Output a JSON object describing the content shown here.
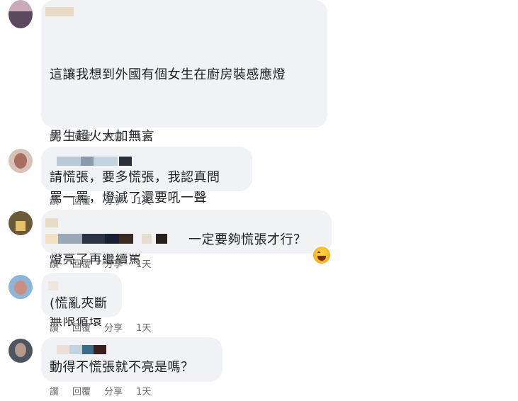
{
  "comments": [
    {
      "lines": [
        "這讓我想到外國有個女生在廚房裝感應燈",
        "男生超火大加無言",
        "罵一罵，燈滅了還要吼一聲",
        "燈亮了再繼續罵",
        "無限循環"
      ],
      "actions": {
        "like": "讚",
        "reply": "回覆",
        "share": "分享",
        "time": "1天"
      }
    },
    {
      "lines": [
        "請慌張，要多慌張，我認真問"
      ],
      "actions": {
        "like": "讚",
        "reply": "回覆",
        "share": "分享",
        "time": "1天"
      }
    },
    {
      "lines": [
        "一定要夠慌張才行？"
      ],
      "actions": {
        "like": "讚",
        "reply": "回覆",
        "share": "分享",
        "time": "1天"
      },
      "reaction": "laughing-emoji"
    },
    {
      "lines": [
        "(慌亂夾斷"
      ],
      "actions": {
        "like": "讚",
        "reply": "回覆",
        "share": "分享",
        "time": "1天"
      }
    },
    {
      "lines": [
        "動得不慌張就不亮是嗎？"
      ],
      "actions": {
        "like": "讚",
        "reply": "回覆",
        "share": "分享",
        "time": "1天"
      }
    }
  ],
  "colors": {
    "bubble": "#f0f2f5",
    "text": "#1c1e21",
    "meta": "#65676b"
  }
}
